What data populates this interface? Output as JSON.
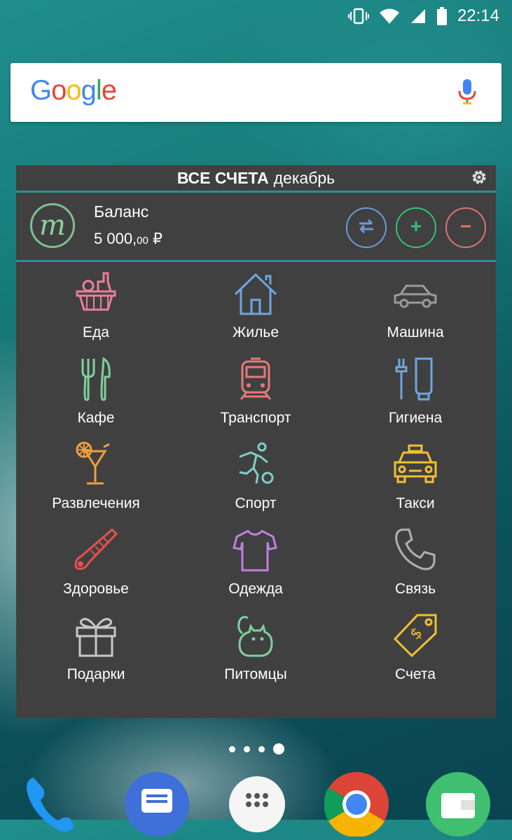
{
  "status_bar": {
    "time": "22:14"
  },
  "search": {
    "logo_text": "Google"
  },
  "widget": {
    "title_bold": "ВСЕ СЧЕТА",
    "title_month": "декабрь",
    "balance_label": "Баланс",
    "balance_main": "5 000,",
    "balance_cents": "00",
    "balance_currency": " ₽",
    "logo_letter": "m",
    "categories": [
      {
        "label": "Еда",
        "icon": "basket-icon",
        "color": "#e87fa0"
      },
      {
        "label": "Жилье",
        "icon": "house-icon",
        "color": "#6fa6e0"
      },
      {
        "label": "Машина",
        "icon": "car-icon",
        "color": "#9a9a9a"
      },
      {
        "label": "Кафе",
        "icon": "cutlery-icon",
        "color": "#7fd0a0"
      },
      {
        "label": "Транспорт",
        "icon": "train-icon",
        "color": "#e87878"
      },
      {
        "label": "Гигиена",
        "icon": "toothbrush-icon",
        "color": "#6fa6e0"
      },
      {
        "label": "Развлечения",
        "icon": "cocktail-icon",
        "color": "#f0a040"
      },
      {
        "label": "Спорт",
        "icon": "football-player-icon",
        "color": "#7fd0c8"
      },
      {
        "label": "Такси",
        "icon": "taxi-icon",
        "color": "#f0c030"
      },
      {
        "label": "Здоровье",
        "icon": "thermometer-icon",
        "color": "#e85050"
      },
      {
        "label": "Одежда",
        "icon": "tshirt-icon",
        "color": "#c080e0"
      },
      {
        "label": "Связь",
        "icon": "phone-icon",
        "color": "#b0b0b0"
      },
      {
        "label": "Подарки",
        "icon": "gift-icon",
        "color": "#c8c8c8"
      },
      {
        "label": "Питомцы",
        "icon": "cat-icon",
        "color": "#7fd0a0"
      },
      {
        "label": "Счета",
        "icon": "price-tag-icon",
        "color": "#f0c030"
      }
    ]
  },
  "page_indicator": {
    "count": 4,
    "active": 4
  }
}
